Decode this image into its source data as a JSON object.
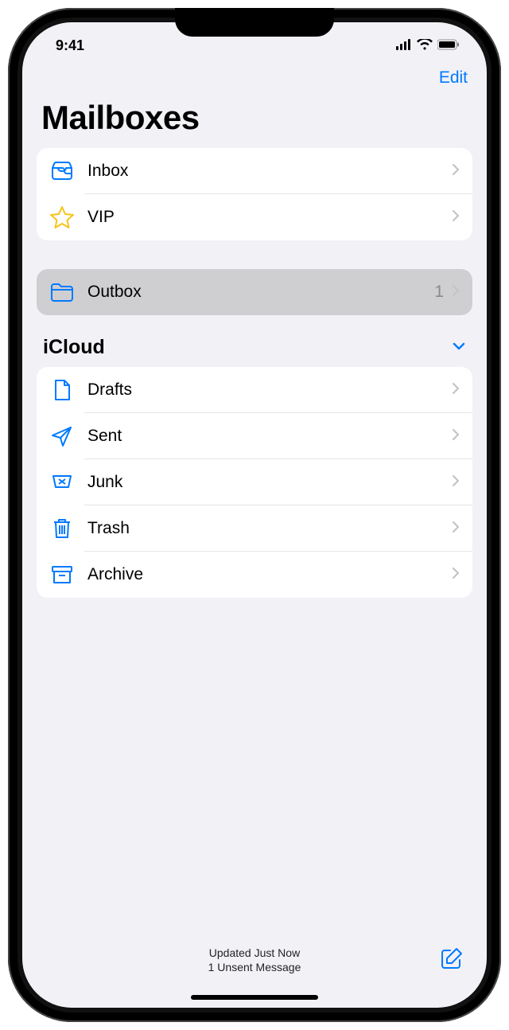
{
  "status": {
    "time": "9:41"
  },
  "nav": {
    "edit_label": "Edit"
  },
  "page_title": "Mailboxes",
  "smart_mailboxes": [
    {
      "label": "Inbox",
      "icon": "inbox-icon"
    },
    {
      "label": "VIP",
      "icon": "star-icon"
    }
  ],
  "outbox": {
    "label": "Outbox",
    "icon": "folder-icon",
    "count": "1"
  },
  "account": {
    "name": "iCloud",
    "folders": [
      {
        "label": "Drafts",
        "icon": "document-icon"
      },
      {
        "label": "Sent",
        "icon": "paperplane-icon"
      },
      {
        "label": "Junk",
        "icon": "junk-icon"
      },
      {
        "label": "Trash",
        "icon": "trash-icon"
      },
      {
        "label": "Archive",
        "icon": "archivebox-icon"
      }
    ]
  },
  "footer": {
    "status_line1": "Updated Just Now",
    "status_line2": "1 Unsent Message"
  },
  "colors": {
    "accent": "#007aff",
    "star": "#f5c518",
    "background": "#f2f1f6",
    "selected": "#cfcfd2"
  }
}
